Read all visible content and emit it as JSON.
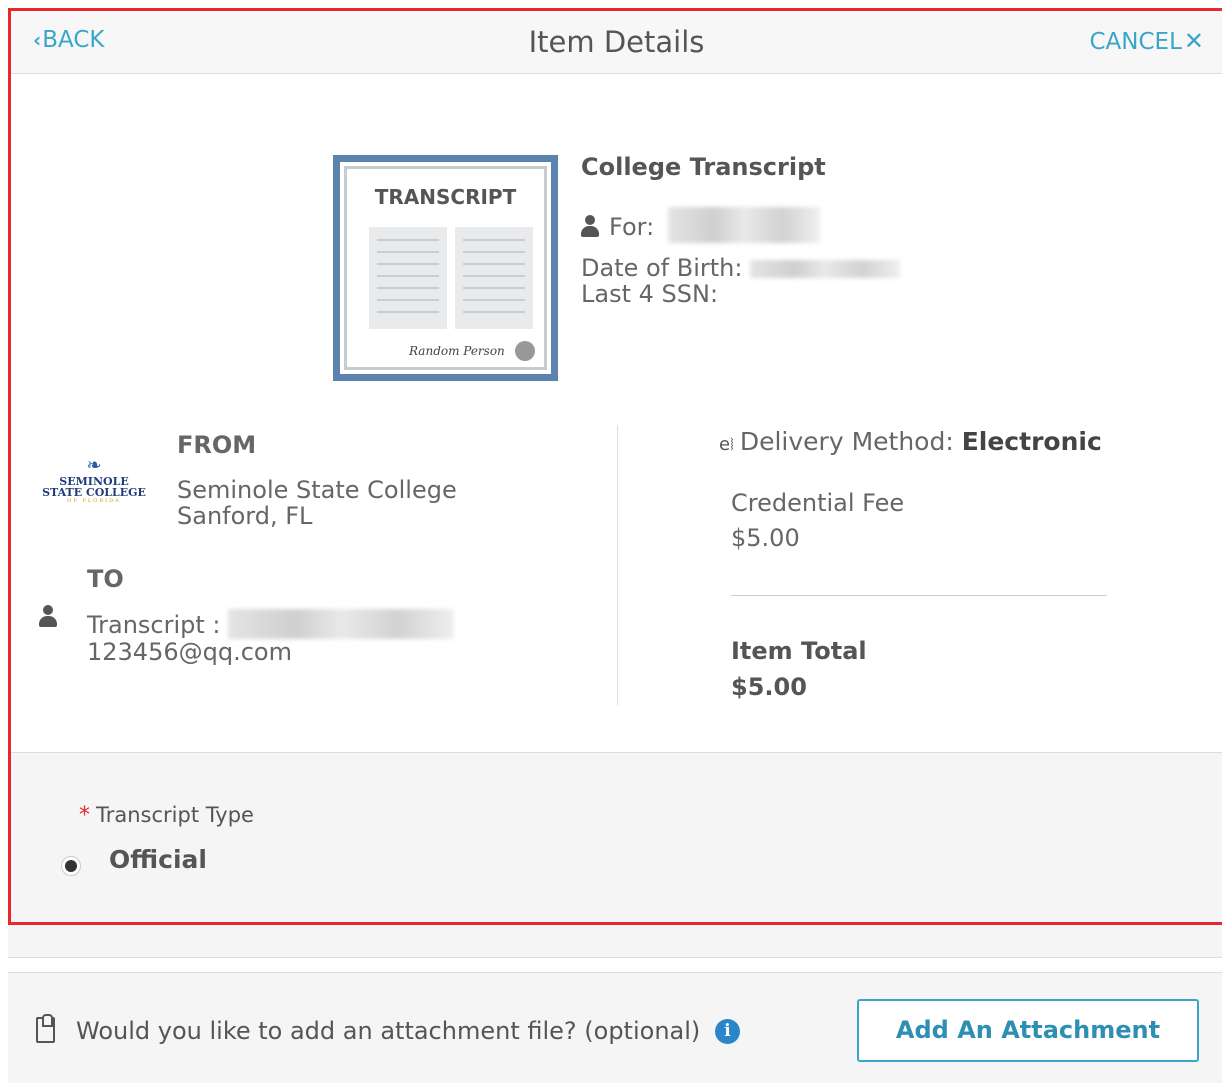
{
  "header": {
    "back_label": "BACK",
    "title": "Item Details",
    "cancel_label": "CANCEL"
  },
  "item": {
    "illustration_title": "TRANSCRIPT",
    "signature": "Random Person",
    "name": "College Transcript",
    "for_label": "For:",
    "dob_label": "Date of Birth:",
    "ssn_label": "Last 4 SSN:"
  },
  "from": {
    "label": "FROM",
    "logo": {
      "line1": "SEMINOLE",
      "line2": "STATE COLLEGE",
      "line3": "OF FLORIDA"
    },
    "institution": "Seminole State College",
    "location": "Sanford, FL"
  },
  "to": {
    "label": "TO",
    "recipient_label": "Transcript :",
    "email": "123456@qq.com"
  },
  "delivery": {
    "label": "Delivery Method:",
    "method": "Electronic"
  },
  "fees": {
    "credential_fee_label": "Credential Fee",
    "credential_fee_value": "$5.00",
    "item_total_label": "Item Total",
    "item_total_value": "$5.00"
  },
  "options": {
    "transcript_type_label": "Transcript Type",
    "selected_type": "Official"
  },
  "attachment": {
    "question": "Would you like to add an attachment file? (optional)",
    "button_label": "Add An Attachment"
  },
  "colors": {
    "accent": "#3aa6c7",
    "highlight_border": "#e8282b",
    "info": "#2a86c8"
  }
}
